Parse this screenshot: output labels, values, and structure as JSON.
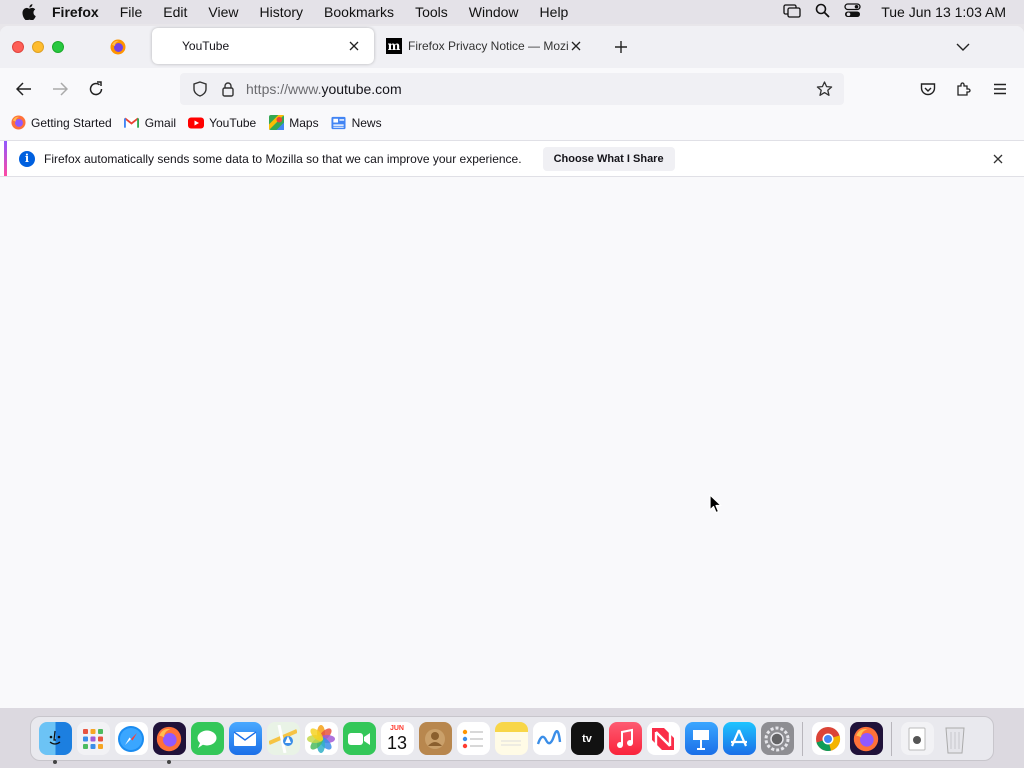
{
  "menubar": {
    "app_name": "Firefox",
    "menus": [
      "File",
      "Edit",
      "View",
      "History",
      "Bookmarks",
      "Tools",
      "Window",
      "Help"
    ],
    "clock": "Tue Jun 13  1:03 AM"
  },
  "tabs": {
    "active": {
      "title": "YouTube"
    },
    "inactive": {
      "title": "Firefox Privacy Notice — Mozilla"
    }
  },
  "urlbar": {
    "url_prefix": "https://www.",
    "url_host": "youtube.com"
  },
  "bookmarks": [
    {
      "label": "Getting Started",
      "icon": "firefox-icon"
    },
    {
      "label": "Gmail",
      "icon": "gmail-icon"
    },
    {
      "label": "YouTube",
      "icon": "youtube-icon"
    },
    {
      "label": "Maps",
      "icon": "maps-icon"
    },
    {
      "label": "News",
      "icon": "news-icon"
    }
  ],
  "notice": {
    "message": "Firefox automatically sends some data to Mozilla so that we can improve your experience.",
    "button_label": "Choose What I Share"
  },
  "dock": {
    "apps": [
      "Finder",
      "Launchpad",
      "Safari",
      "Firefox",
      "Messages",
      "Mail",
      "Maps",
      "Photos",
      "FaceTime",
      "Calendar",
      "Contacts",
      "Reminders",
      "Notes",
      "Freeform",
      "TV",
      "Music",
      "News",
      "Keynote",
      "App Store",
      "System Settings",
      "Chrome",
      "Firefox",
      "Downloads",
      "Trash"
    ],
    "calendar_month": "JUN",
    "calendar_day": "13",
    "tv_label": "tv"
  }
}
